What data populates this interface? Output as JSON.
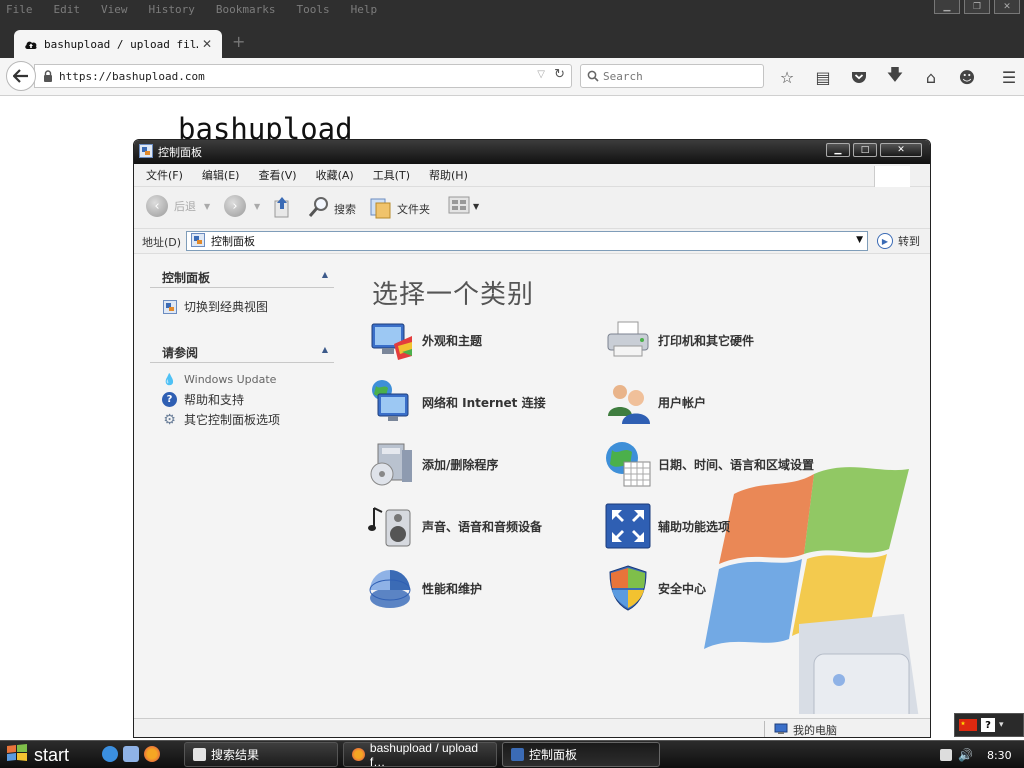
{
  "firefox": {
    "menu": [
      "File",
      "Edit",
      "View",
      "History",
      "Bookmarks",
      "Tools",
      "Help"
    ],
    "tab_title": "bashupload / upload fil…",
    "url": "https://bashupload.com",
    "search_placeholder": "Search",
    "page_heading": "bashupload"
  },
  "control_panel": {
    "title": "控制面板",
    "menu": [
      "文件(F)",
      "编辑(E)",
      "查看(V)",
      "收藏(A)",
      "工具(T)",
      "帮助(H)"
    ],
    "toolbar": {
      "back": "后退",
      "search": "搜索",
      "folders": "文件夹"
    },
    "address": {
      "label": "地址(D)",
      "value": "控制面板",
      "go": "转到"
    },
    "sidebar": {
      "panel_title": "控制面板",
      "switch_view": "切换到经典视图",
      "see_also_title": "请参阅",
      "see_also": [
        "Windows Update",
        "帮助和支持",
        "其它控制面板选项"
      ]
    },
    "heading": "选择一个类别",
    "categories": [
      {
        "label": "外观和主题",
        "icon": "appearance-themes-icon"
      },
      {
        "label": "打印机和其它硬件",
        "icon": "printer-icon"
      },
      {
        "label": "网络和 Internet 连接",
        "icon": "network-icon"
      },
      {
        "label": "用户帐户",
        "icon": "users-icon"
      },
      {
        "label": "添加/删除程序",
        "icon": "add-remove-programs-icon"
      },
      {
        "label": "日期、时间、语言和区域设置",
        "icon": "date-time-globe-icon"
      },
      {
        "label": "声音、语音和音频设备",
        "icon": "speaker-icon"
      },
      {
        "label": "辅助功能选项",
        "icon": "accessibility-icon"
      },
      {
        "label": "性能和维护",
        "icon": "performance-chart-icon"
      },
      {
        "label": "安全中心",
        "icon": "security-shield-icon"
      }
    ],
    "status": "我的电脑"
  },
  "taskbar": {
    "start": "start",
    "buttons": [
      "搜索结果",
      "bashupload / upload f…",
      "控制面板"
    ],
    "clock": "8:30"
  },
  "colors": {
    "xp_blue": "#3b6bb5",
    "firefox_dark": "#2f2f2f"
  }
}
